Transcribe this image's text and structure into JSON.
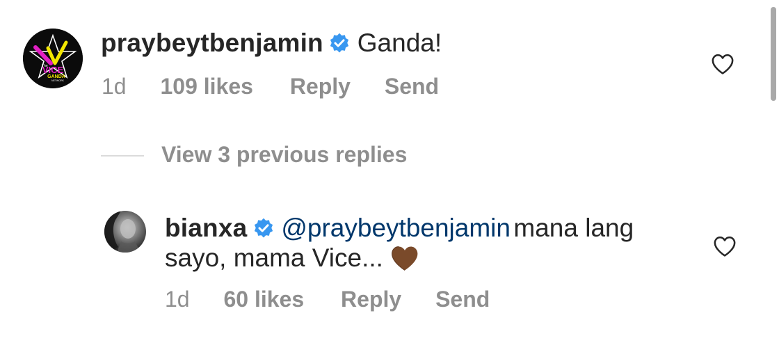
{
  "comments": [
    {
      "username": "praybeytbenjamin",
      "text": "Ganda!",
      "time": "1d",
      "likes": "109 likes",
      "reply": "Reply",
      "send": "Send",
      "avatar_text_top": "The",
      "avatar_text_main": "VICE",
      "avatar_text_sub": "GANDA",
      "avatar_text_bottom": "NETWORK"
    },
    {
      "username": "bianxa",
      "mention": "@praybeytbenjamin",
      "text_line1": "mana lang",
      "text_line2": "sayo, mama Vice...",
      "time": "1d",
      "likes": "60 likes",
      "reply": "Reply",
      "send": "Send"
    }
  ],
  "view_replies": "View 3 previous replies",
  "colors": {
    "verified": "#3897f0",
    "mention": "#00376b",
    "meta": "#8e8e8e",
    "brown_heart": "#7a4a2a"
  }
}
